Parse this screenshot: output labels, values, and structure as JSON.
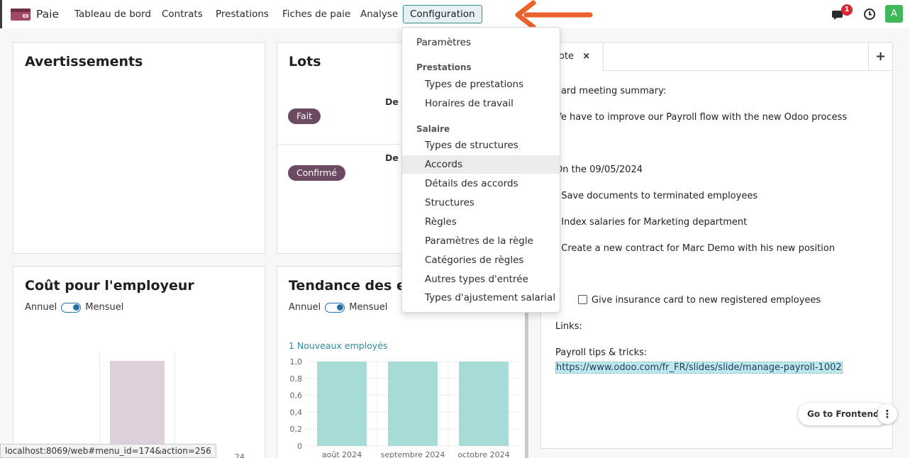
{
  "navbar": {
    "app_name": "Paie",
    "items": [
      "Tableau de bord",
      "Contrats",
      "Prestations",
      "Fiches de paie",
      "Analyse"
    ],
    "active_item": "Configuration",
    "badge_count": "1",
    "avatar_letter": "A"
  },
  "dropdown": {
    "top_item": "Paramètres",
    "sections": [
      {
        "header": "Prestations",
        "items": [
          "Types de prestations",
          "Horaires de travail"
        ]
      },
      {
        "header": "Salaire",
        "items": [
          "Types de structures",
          "Accords",
          "Détails des accords",
          "Structures",
          "Règles",
          "Paramètres de la règle",
          "Catégories de règles",
          "Autres types d'entrée",
          "Types d'ajustement salarial"
        ]
      }
    ],
    "highlighted_item": "Accords"
  },
  "cards": {
    "warnings": {
      "title": "Avertissements"
    },
    "batches": {
      "title": "Lots",
      "rows": [
        {
          "date_prefix": "De (",
          "status": "Fait"
        },
        {
          "date_prefix": "De (",
          "status": "Confirmé"
        }
      ]
    },
    "employer_cost": {
      "title": "Coût pour l'employeur",
      "toggle_left": "Annuel",
      "toggle_right": "Mensuel",
      "partial_tick": "24"
    },
    "employee_trend": {
      "title": "Tendance des em",
      "toggle_left": "Annuel",
      "toggle_right": "Mensuel"
    }
  },
  "chart_data": {
    "type": "bar",
    "categories": [
      "août 2024",
      "septembre 2024",
      "octobre 2024"
    ],
    "series": [
      {
        "name": "Nouveaux employés",
        "values": [
          1,
          1,
          1
        ]
      }
    ],
    "legend_label": "1 Nouveaux employés",
    "yticks": [
      "1,0",
      "0,8",
      "0,6",
      "0,4",
      "0,2",
      "0"
    ],
    "ylim": [
      0,
      1.0
    ],
    "color": "#a6dbd6"
  },
  "note": {
    "tab_label": "ote",
    "close_symbol": "×",
    "add_symbol": "+",
    "lines": [
      "oard meeting summary:",
      "Ve have to improve our Payroll flow with the new Odoo process",
      "On the 09/05/2024",
      ". Save documents to terminated employees",
      ". Index salaries for Marketing department",
      ". Create a new contract for Marc Demo with his new position"
    ],
    "checkbox_label": "Give insurance card to new registered employees",
    "links_label": "Links:",
    "tips_label": "Payroll tips & tricks:",
    "link_url": "https://www.odoo.com/fr_FR/slides/slide/manage-payroll-1002"
  },
  "footer": {
    "status_url": "localhost:8069/web#menu_id=174&action=256",
    "frontend_button": "Go to Frontend",
    "kebab_symbol": "⋮"
  },
  "colors": {
    "accent": "#2e8c8d",
    "badge_pill": "#6b4a62",
    "chart_bar": "#a6dbd6",
    "cost_bar": "#ddd0da",
    "arrow": "#e8622a",
    "avatar": "#3fb85a"
  }
}
